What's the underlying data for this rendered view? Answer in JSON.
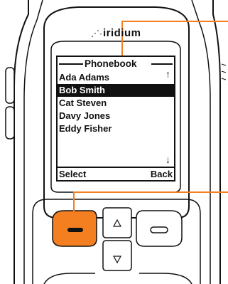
{
  "brand": {
    "dots": "⋰·",
    "name": "iridium"
  },
  "screen": {
    "title": "Phonebook",
    "scroll_up_symbol": "↑",
    "scroll_down_symbol": "↓",
    "contacts": [
      {
        "name": "Ada Adams",
        "selected": false
      },
      {
        "name": "Bob Smith",
        "selected": true
      },
      {
        "name": "Cat Steven",
        "selected": false
      },
      {
        "name": "Davy Jones",
        "selected": false
      },
      {
        "name": "Eddy Fisher",
        "selected": false
      }
    ],
    "softkeys": {
      "left": "Select",
      "right": "Back"
    }
  },
  "colors": {
    "left_softkey_button": "#f47f20",
    "callout_line": "#f47f20",
    "outline": "#111111"
  },
  "icons": {
    "nav_up": "triangle-up-icon",
    "nav_down": "triangle-down-icon",
    "left_softkey": "dash-icon",
    "right_softkey": "dash-icon"
  }
}
